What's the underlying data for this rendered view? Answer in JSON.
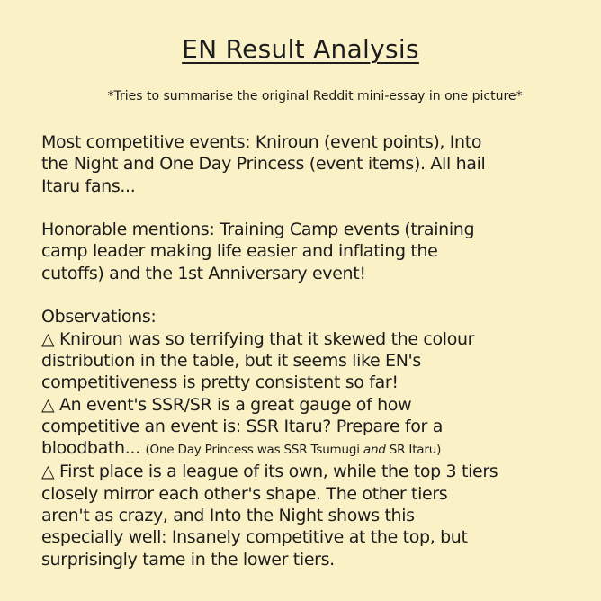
{
  "title": "EN Result Analysis",
  "subtitle": "*Tries to summarise the original Reddit mini-essay in one picture*",
  "competitive": {
    "line1": "Most competitive events: Kniroun (event points), Into",
    "line2": "the Night and One Day Princess (event items). All hail",
    "line3": "Itaru fans..."
  },
  "honorable": {
    "line1": "Honorable mentions: Training Camp events (training",
    "line2": "camp leader making life easier and inflating the",
    "line3": "cutoffs) and the 1st Anniversary event!"
  },
  "observations": {
    "heading": "Observations:",
    "obs1_line1": "△ Kniroun was so terrifying that it skewed the colour",
    "obs1_line2": "distribution in the table, but it seems like EN's",
    "obs1_line3": "competitiveness is pretty consistent so far!",
    "obs2_line1": "△ An event's SSR/SR is a great gauge of how",
    "obs2_line2": "competitive an event is: SSR Itaru? Prepare for a",
    "obs2_line3_main": "bloodbath... ",
    "obs2_note_a": "(One Day Princess was SSR Tsumugi ",
    "obs2_note_em": "and",
    "obs2_note_b": " SR Itaru)",
    "obs3_line1": "△ First place is a league of its own, while the top 3 tiers",
    "obs3_line2": "closely mirror each other's shape. The other tiers",
    "obs3_line3": "aren't as crazy, and Into the Night shows this",
    "obs3_line4": "especially well: Insanely competitive at the top, but",
    "obs3_line5": "surprisingly tame in the lower tiers."
  }
}
